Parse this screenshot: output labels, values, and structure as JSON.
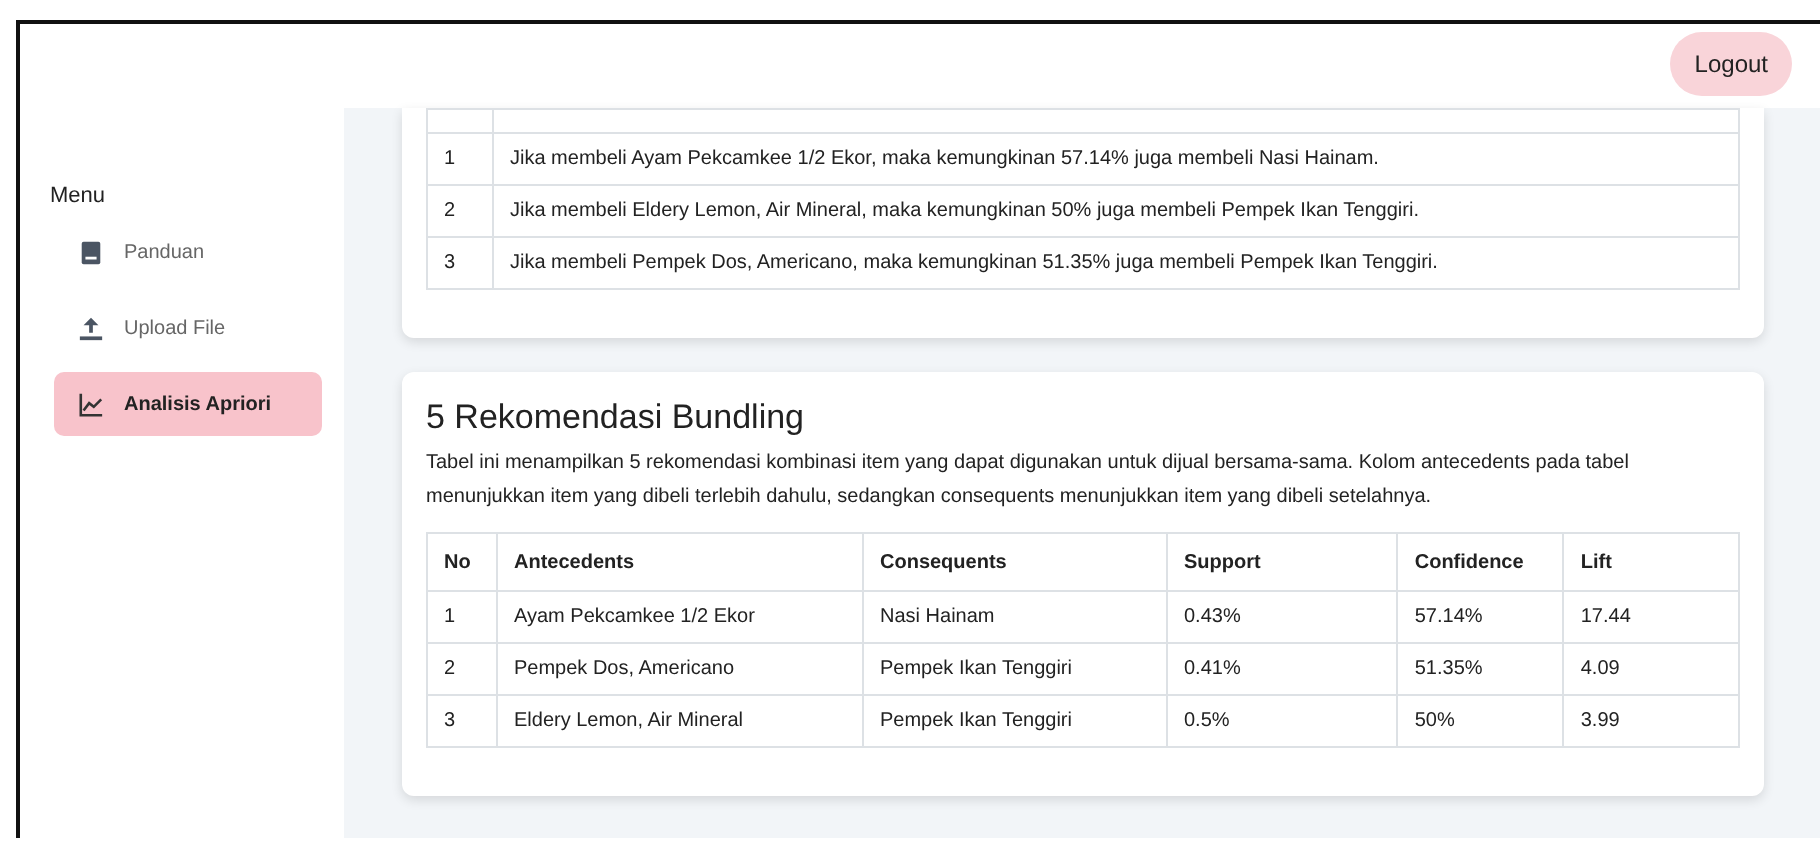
{
  "header": {
    "logout": "Logout"
  },
  "sidebar": {
    "title": "Menu",
    "items": [
      {
        "label": "Panduan",
        "kind": "book",
        "selected": false
      },
      {
        "label": "Upload File",
        "kind": "upload",
        "selected": false
      },
      {
        "label": "Analisis Apriori",
        "kind": "chart",
        "selected": true
      }
    ]
  },
  "rules_card": {
    "rows": [
      {
        "no": "1",
        "text": "Jika membeli Ayam Pekcamkee 1/2 Ekor, maka kemungkinan 57.14% juga membeli Nasi Hainam."
      },
      {
        "no": "2",
        "text": "Jika membeli Eldery Lemon, Air Mineral, maka kemungkinan 50% juga membeli Pempek Ikan Tenggiri."
      },
      {
        "no": "3",
        "text": "Jika membeli Pempek Dos, Americano, maka kemungkinan 51.35% juga membeli Pempek Ikan Tenggiri."
      }
    ]
  },
  "bundling_card": {
    "title": "5 Rekomendasi Bundling",
    "description": "Tabel ini menampilkan 5 rekomendasi kombinasi item yang dapat digunakan untuk dijual bersama-sama. Kolom antecedents pada tabel menunjukkan item yang dibeli terlebih dahulu, sedangkan consequents menunjukkan item yang dibeli setelahnya.",
    "columns": [
      "No",
      "Antecedents",
      "Consequents",
      "Support",
      "Confidence",
      "Lift"
    ],
    "rows": [
      [
        "1",
        "Ayam Pekcamkee 1/2 Ekor",
        "Nasi Hainam",
        "0.43%",
        "57.14%",
        "17.44"
      ],
      [
        "2",
        "Pempek Dos, Americano",
        "Pempek Ikan Tenggiri",
        "0.41%",
        "51.35%",
        "4.09"
      ],
      [
        "3",
        "Eldery Lemon, Air Mineral",
        "Pempek Ikan Tenggiri",
        "0.5%",
        "50%",
        "3.99"
      ]
    ]
  }
}
